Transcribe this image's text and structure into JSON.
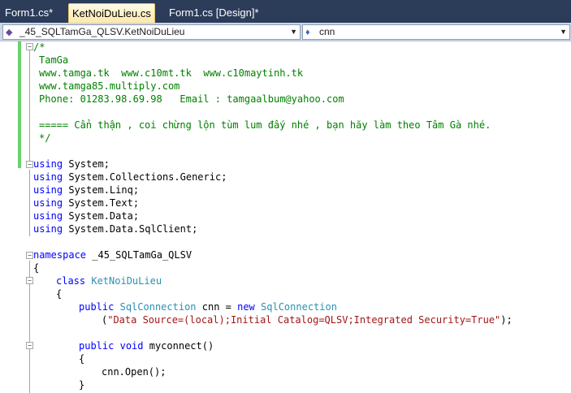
{
  "tabs": [
    {
      "label": "Form1.cs*"
    },
    {
      "label": "KetNoiDuLieu.cs"
    },
    {
      "label": "Form1.cs [Design]*"
    }
  ],
  "nav": {
    "type_selector": "_45_SQLTamGa_QLSV.KetNoiDuLieu",
    "member_selector": "cnn"
  },
  "code": {
    "comment": [
      "/*",
      "TamGa",
      "www.tamga.tk  www.c10mt.tk  www.c10maytinh.tk",
      "www.tamga85.multiply.com",
      "Phone: 01283.98.69.98   Email : tamgaalbum@yahoo.com",
      "",
      "===== Cẩn thận , coi chừng lộn tùm lum đấy nhé , bạn hãy làm theo Tâm Gà nhé.",
      "*/"
    ],
    "using_kw": "using",
    "usings": [
      " System;",
      " System.Collections.Generic;",
      " System.Linq;",
      " System.Text;",
      " System.Data;",
      " System.Data.SqlClient;"
    ],
    "namespace_kw": "namespace",
    "namespace_name": " _45_SQLTamGa_QLSV",
    "open_brace": "{",
    "close_brace": "}",
    "class_kw": "class",
    "class_name": "KetNoiDuLieu",
    "public_kw": "public",
    "new_kw": "new",
    "void_kw": "void",
    "sqlconnection_type": "SqlConnection",
    "field_name": " cnn = ",
    "conn_string_open": "(",
    "conn_string": "\"Data Source=(local);Initial Catalog=QLSV;Integrated Security=True\"",
    "conn_string_close": ");",
    "method_sig": " myconnect()",
    "open_call": "cnn.Open();"
  }
}
